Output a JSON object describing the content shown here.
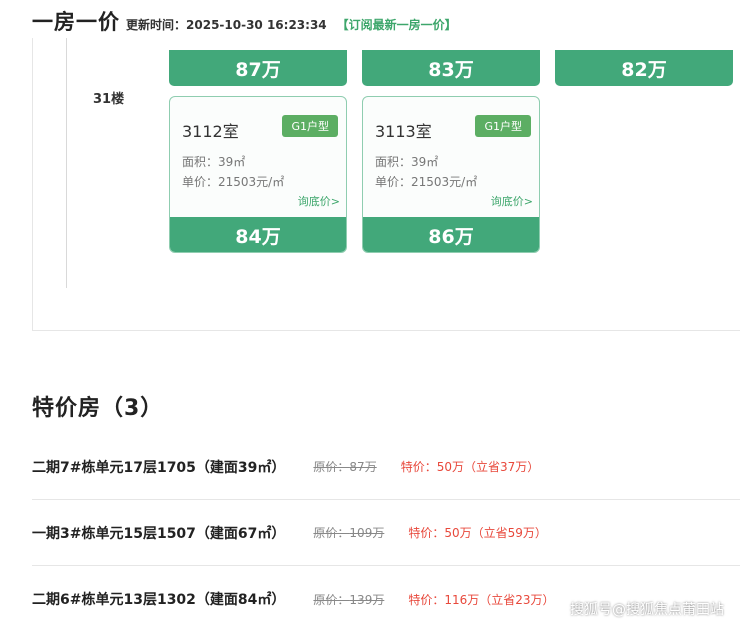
{
  "header": {
    "title": "一房一价",
    "update_label": "更新时间：",
    "update_time": "2025-10-30 16:23:34",
    "subscribe": "【订阅最新一房一价】"
  },
  "top_row_prices": [
    "87万",
    "83万",
    "82万"
  ],
  "floor": {
    "label": "31楼",
    "rooms": [
      {
        "room": "3112室",
        "type": "G1户型",
        "area": "面积：39㎡",
        "unit_price": "单价：21503元/㎡",
        "ask": "询底价>",
        "price": "84万"
      },
      {
        "room": "3113室",
        "type": "G1户型",
        "area": "面积：39㎡",
        "unit_price": "单价：21503元/㎡",
        "ask": "询底价>",
        "price": "86万"
      }
    ]
  },
  "specials": {
    "title": "特价房（3）",
    "items": [
      {
        "name": "二期7#栋单元17层1705（建面39㎡）",
        "orig_label": "原价：",
        "orig_value": "87万",
        "special": "特价：50万（立省37万）"
      },
      {
        "name": "一期3#栋单元15层1507（建面67㎡）",
        "orig_label": "原价：",
        "orig_value": "109万",
        "special": "特价：50万（立省59万）"
      },
      {
        "name": "二期6#栋单元13层1302（建面84㎡）",
        "orig_label": "原价：",
        "orig_value": "139万",
        "special": "特价：116万（立省23万）"
      }
    ]
  },
  "watermark": "搜狐号@搜狐焦点莆田站",
  "colors": {
    "accent_green": "#42a87a",
    "type_badge": "#5cae63",
    "special_red": "#e8483b",
    "link_green": "#3da66b"
  }
}
